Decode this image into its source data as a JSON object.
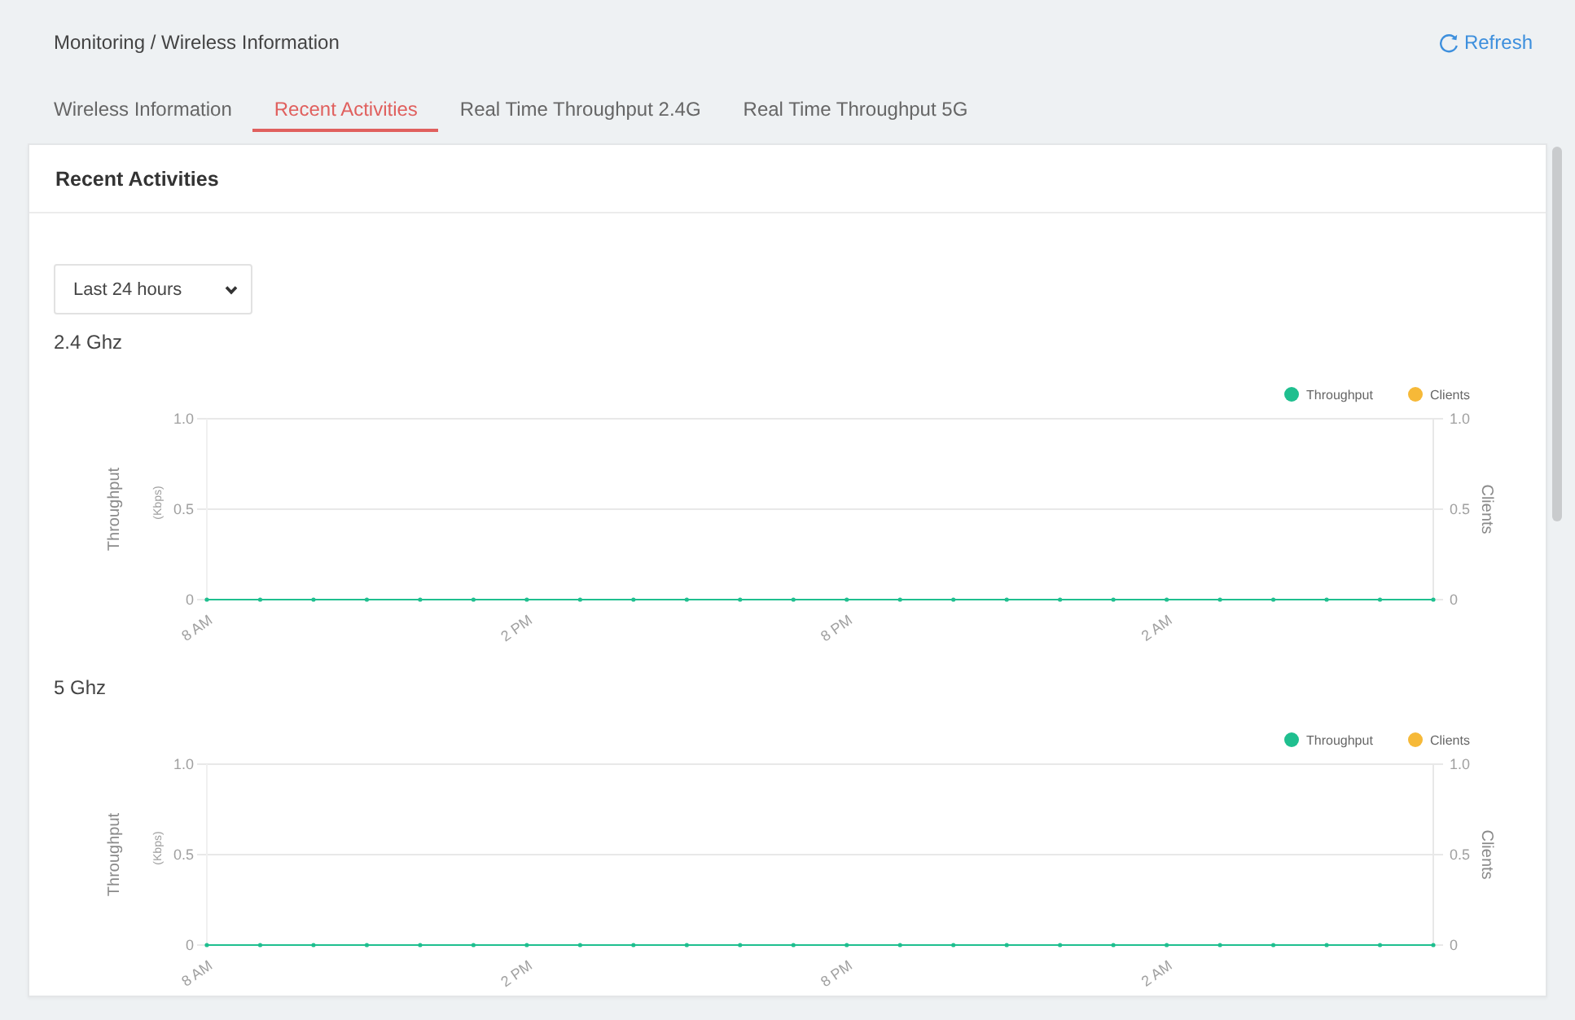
{
  "header": {
    "breadcrumb": "Monitoring / Wireless Information",
    "refresh": "Refresh"
  },
  "tabs": [
    {
      "label": "Wireless Information",
      "selected": false
    },
    {
      "label": "Recent Activities",
      "selected": true
    },
    {
      "label": "Real Time Throughput 2.4G",
      "selected": false
    },
    {
      "label": "Real Time Throughput 5G",
      "selected": false
    }
  ],
  "card": {
    "title": "Recent Activities",
    "range_select": {
      "value": "Last 24 hours"
    },
    "charts": [
      {
        "title": "2.4 Ghz",
        "y_unit": "(Kbps)",
        "right_axis": {
          "label": "Clients",
          "ticks": [
            "1.0",
            "0.5",
            "0"
          ]
        },
        "chart_data": {
          "type": "line",
          "ylabel": "Throughput",
          "legend": "top-right",
          "categories": [
            "8 AM",
            null,
            null,
            null,
            null,
            null,
            "2 PM",
            null,
            null,
            null,
            null,
            null,
            "8 PM",
            null,
            null,
            null,
            null,
            null,
            "2 AM",
            null,
            null,
            null,
            null,
            null
          ],
          "ylim": [
            0,
            1
          ],
          "yticks": [
            {
              "value": 1,
              "label": "1.0"
            },
            {
              "value": 0.5,
              "label": "0.5"
            },
            {
              "value": 0,
              "label": "0"
            }
          ],
          "series": [
            {
              "name": "Throughput",
              "color": "#1fbf8f",
              "values": [
                0,
                0,
                0,
                0,
                0,
                0,
                0,
                0,
                0,
                0,
                0,
                0,
                0,
                0,
                0,
                0,
                0,
                0,
                0,
                0,
                0,
                0,
                0,
                0
              ]
            },
            {
              "name": "Clients",
              "color": "#f6b938",
              "values": [
                null,
                null,
                null,
                null,
                null,
                null,
                null,
                null,
                null,
                null,
                null,
                null,
                null,
                null,
                null,
                null,
                null,
                null,
                null,
                null,
                null,
                null,
                null,
                null
              ]
            }
          ]
        }
      },
      {
        "title": "5 Ghz",
        "y_unit": "(Kbps)",
        "right_axis": {
          "label": "Clients",
          "ticks": [
            "1.0",
            "0.5",
            "0"
          ]
        },
        "chart_data": {
          "type": "line",
          "ylabel": "Throughput",
          "legend": "top-right",
          "categories": [
            "8 AM",
            null,
            null,
            null,
            null,
            null,
            "2 PM",
            null,
            null,
            null,
            null,
            null,
            "8 PM",
            null,
            null,
            null,
            null,
            null,
            "2 AM",
            null,
            null,
            null,
            null,
            null
          ],
          "ylim": [
            0,
            1
          ],
          "yticks": [
            {
              "value": 1,
              "label": "1.0"
            },
            {
              "value": 0.5,
              "label": "0.5"
            },
            {
              "value": 0,
              "label": "0"
            }
          ],
          "series": [
            {
              "name": "Throughput",
              "color": "#1fbf8f",
              "values": [
                0,
                0,
                0,
                0,
                0,
                0,
                0,
                0,
                0,
                0,
                0,
                0,
                0,
                0,
                0,
                0,
                0,
                0,
                0,
                0,
                0,
                0,
                0,
                0
              ]
            },
            {
              "name": "Clients",
              "color": "#f6b938",
              "values": [
                null,
                null,
                null,
                null,
                null,
                null,
                null,
                null,
                null,
                null,
                null,
                null,
                null,
                null,
                null,
                null,
                null,
                null,
                null,
                null,
                null,
                null,
                null,
                null
              ]
            }
          ]
        }
      }
    ]
  }
}
